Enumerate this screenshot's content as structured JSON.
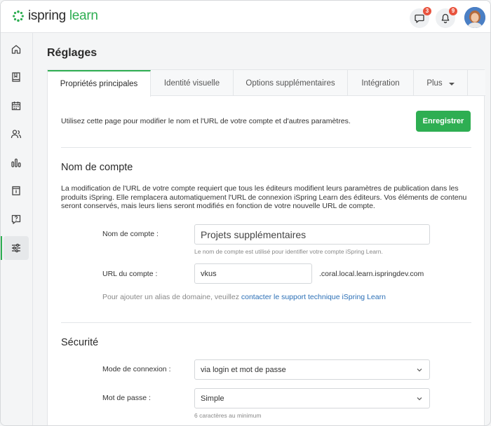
{
  "header": {
    "logo_prefix": "ispring",
    "logo_suffix": "learn",
    "messages_badge": "3",
    "notifications_badge": "9"
  },
  "sidebar": {
    "items": [
      "home-icon",
      "book-icon",
      "calendar-icon",
      "users-icon",
      "reports-icon",
      "info-icon",
      "help-icon",
      "settings-icon"
    ],
    "active": "settings-icon"
  },
  "page": {
    "title": "Réglages"
  },
  "tabs": [
    "Propriétés principales",
    "Identité visuelle",
    "Options supplémentaires",
    "Intégration",
    "Plus"
  ],
  "intro": {
    "text": "Utilisez cette page pour modifier le nom et l'URL de votre compte et d'autres paramètres.",
    "save_label": "Enregistrer"
  },
  "account": {
    "title": "Nom de compte",
    "description": "La modification de l'URL de votre compte requiert que tous les éditeurs modifient leurs paramètres de publication dans les produits iSpring. Elle remplacera automatiquement l'URL de connexion iSpring Learn des éditeurs. Vos éléments de contenu seront conservés, mais leurs liens seront modifiés en fonction de votre nouvelle URL de compte.",
    "name_label": "Nom de compte :",
    "name_value": "Projets supplémentaires",
    "name_hint": "Le nom de compte est utilisé pour identifier votre compte iSpring Learn.",
    "url_label": "URL du compte :",
    "url_value": "vkus",
    "url_suffix": ".coral.local.learn.ispringdev.com",
    "alias_text": "Pour ajouter un alias de domaine, veuillez",
    "alias_link": "contacter le support technique iSpring Learn"
  },
  "security": {
    "title": "Sécurité",
    "login_label": "Mode de connexion :",
    "login_value": "via login et mot de passe",
    "password_label": "Mot de passe :",
    "password_value": "Simple",
    "password_hint": "6 caractères au minimum"
  },
  "colors": {
    "accent": "#2eae52",
    "link": "#2b6fb6",
    "badge": "#e8533e"
  }
}
